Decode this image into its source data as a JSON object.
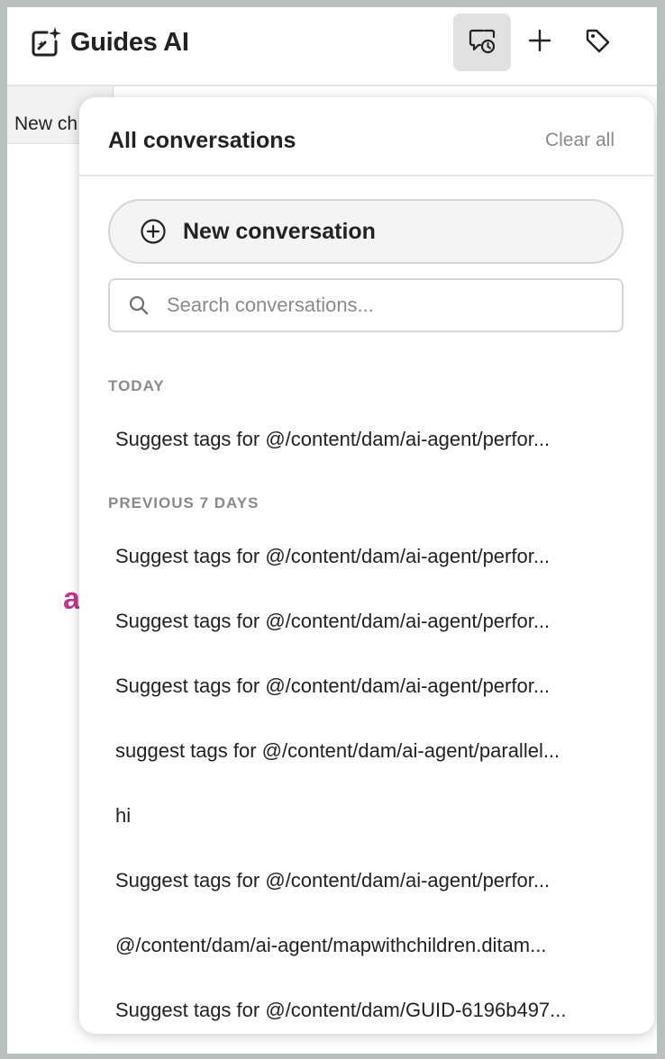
{
  "header": {
    "title": "Guides AI",
    "icons": {
      "app": "sparkle-edit-icon",
      "history": "chat-history-icon",
      "new": "plus-icon",
      "tag": "tag-icon"
    }
  },
  "background": {
    "tab_label": "New ch",
    "partial_letter": "a",
    "accent_color": "#c2378f"
  },
  "popover": {
    "title": "All conversations",
    "clear_all_label": "Clear all",
    "new_conversation_label": "New conversation",
    "search_placeholder": "Search conversations...",
    "sections": [
      {
        "label": "TODAY",
        "items": [
          "Suggest tags for @/content/dam/ai-agent/perfor..."
        ]
      },
      {
        "label": "PREVIOUS 7 DAYS",
        "items": [
          "Suggest tags for @/content/dam/ai-agent/perfor...",
          "Suggest tags for @/content/dam/ai-agent/perfor...",
          "Suggest tags for @/content/dam/ai-agent/perfor...",
          "suggest tags for @/content/dam/ai-agent/parallel...",
          "hi",
          "Suggest tags for @/content/dam/ai-agent/perfor...",
          "@/content/dam/ai-agent/mapwithchildren.ditam...",
          "Suggest tags for @/content/dam/GUID-6196b497..."
        ]
      }
    ]
  }
}
